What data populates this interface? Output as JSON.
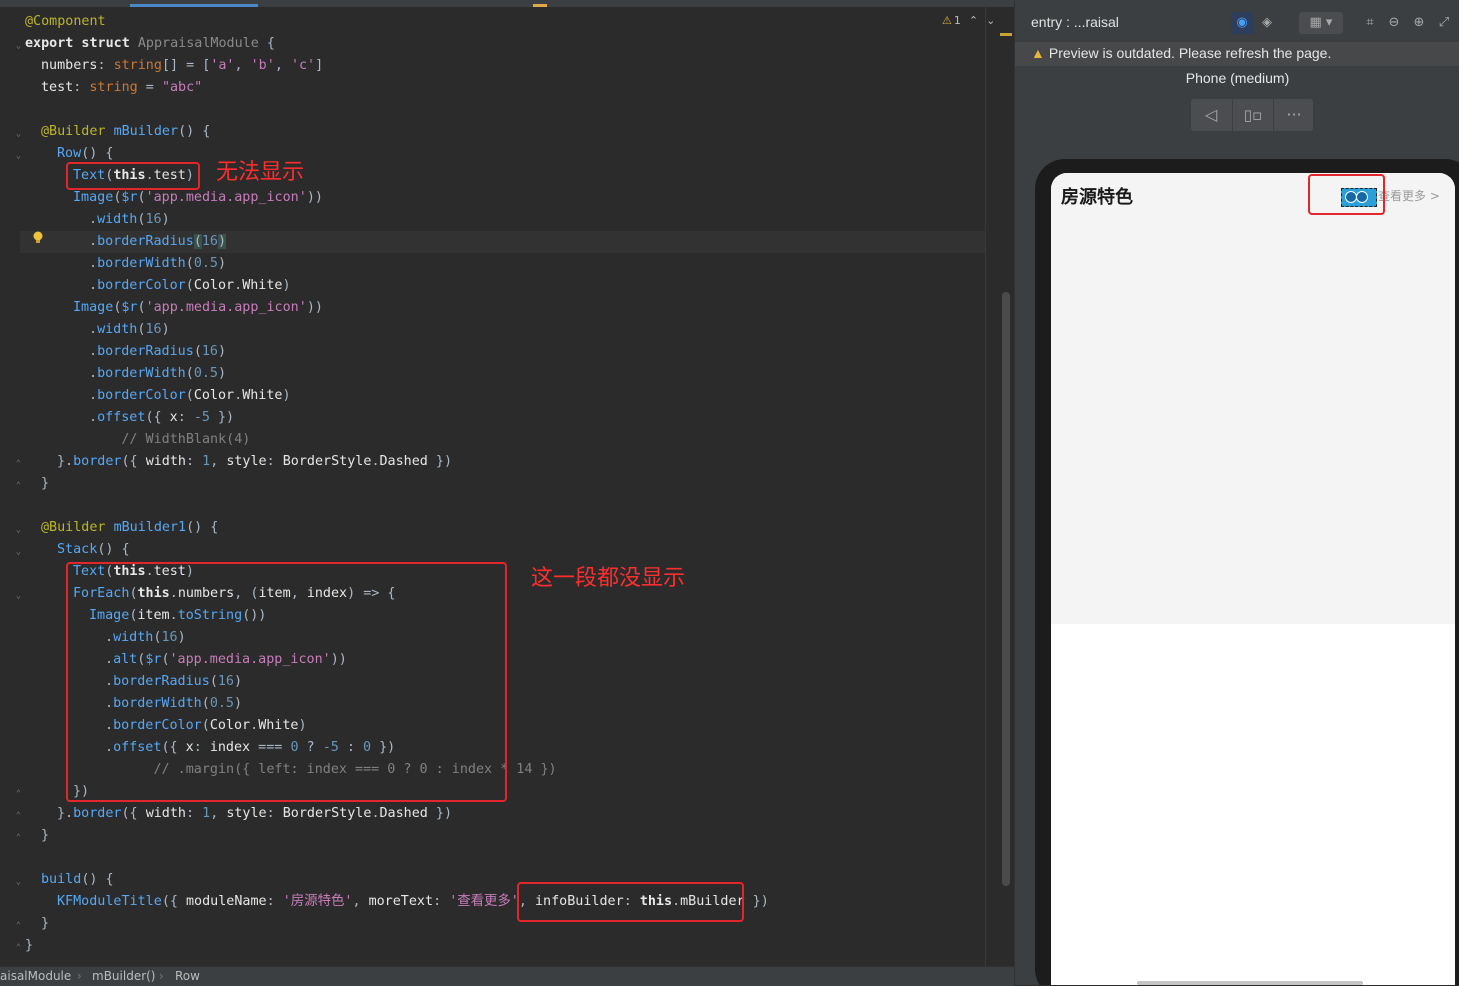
{
  "editor": {
    "warnings": {
      "icon": "warning-icon",
      "count": "1"
    },
    "lines": [
      "@Component",
      "export struct AppraisalModule {",
      "  numbers: string[] = ['a', 'b', 'c']",
      "  test: string = \"abc\"",
      "",
      "  @Builder mBuilder() {",
      "    Row() {",
      "      Text(this.test)",
      "      Image($r('app.media.app_icon'))",
      "        .width(16)",
      "        .borderRadius(16)",
      "        .borderWidth(0.5)",
      "        .borderColor(Color.White)",
      "      Image($r('app.media.app_icon'))",
      "        .width(16)",
      "        .borderRadius(16)",
      "        .borderWidth(0.5)",
      "        .borderColor(Color.White)",
      "        .offset({ x: -5 })",
      "      // WidthBlank(4)",
      "    }.border({ width: 1, style: BorderStyle.Dashed })",
      "  }",
      "",
      "  @Builder mBuilder1() {",
      "    Stack() {",
      "      Text(this.test)",
      "      ForEach(this.numbers, (item, index) => {",
      "        Image(item.toString())",
      "          .width(16)",
      "          .alt($r('app.media.app_icon'))",
      "          .borderRadius(16)",
      "          .borderWidth(0.5)",
      "          .borderColor(Color.White)",
      "          .offset({ x: index === 0 ? -5 : 0 })",
      "        // .margin({ left: index === 0 ? 0 : index * 14 })",
      "      })",
      "    }.border({ width: 1, style: BorderStyle.Dashed })",
      "  }",
      "",
      "  build() {",
      "    KFModuleTitle({ moduleName: '房源特色', moreText: '查看更多', infoBuilder: this.mBuilder })",
      "  }",
      "}"
    ],
    "annotations": {
      "cannot_display": "无法显示",
      "section_not_displayed": "这一段都没显示"
    }
  },
  "breadcrumb": [
    "aisalModule",
    "mBuilder()",
    "Row"
  ],
  "preview": {
    "title": "entry : ...raisal",
    "warning": "Preview is outdated. Please refresh the page.",
    "device": "Phone (medium)",
    "module_name": "房源特色",
    "more_text": "查看更多",
    "more_chevron": ">"
  },
  "colors": {
    "annotation_red": "#e3262b",
    "editor_bg": "#2b2b2b",
    "panel_bg": "#3c3f41"
  }
}
